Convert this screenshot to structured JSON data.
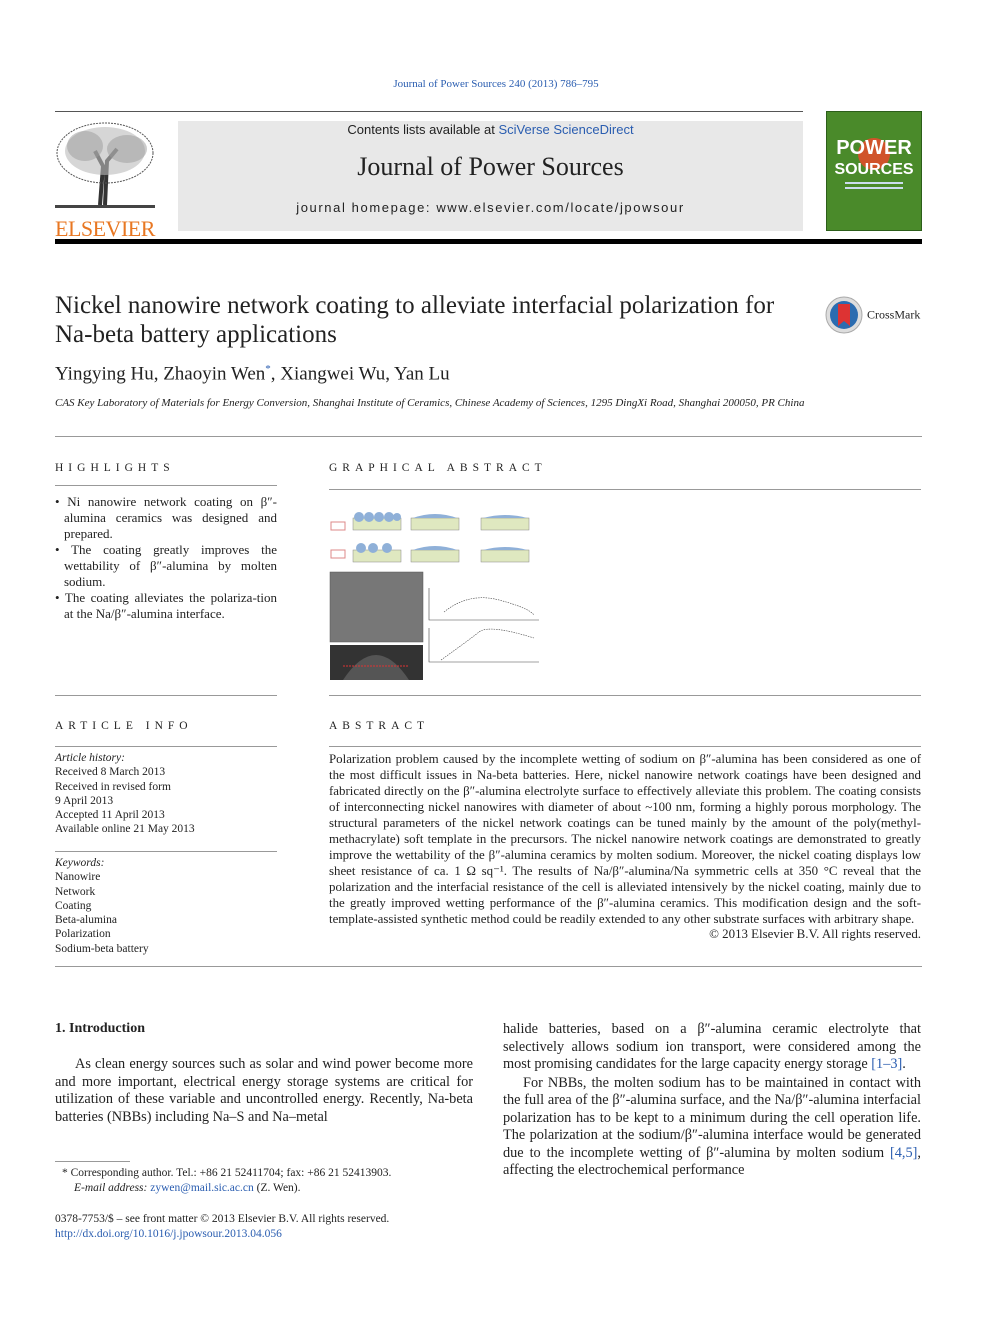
{
  "header": {
    "citation": "Journal of Power Sources 240 (2013) 786–795",
    "contents_prefix": "Contents lists available at ",
    "contents_link": "SciVerse ScienceDirect",
    "journal_title": "Journal of Power Sources",
    "homepage": "journal homepage: www.elsevier.com/locate/jpowsour",
    "publisher_logo": "ELSEVIER",
    "cover_title": "POWER SOURCES",
    "crossmark": "CrossMark"
  },
  "article": {
    "title": "Nickel nanowire network coating to alleviate interfacial polarization for Na-beta battery applications",
    "authors_a": "Yingying Hu, Zhaoyin Wen",
    "author_mark": "*",
    "authors_b": ", Xiangwei Wu, Yan Lu",
    "affiliation": "CAS Key Laboratory of Materials for Energy Conversion, Shanghai Institute of Ceramics, Chinese Academy of Sciences, 1295 DingXi Road, Shanghai 200050, PR China"
  },
  "highlights": {
    "heading": "HIGHLIGHTS",
    "items": [
      "Ni nanowire network coating on β″-alumina ceramics was designed and prepared.",
      "The coating greatly improves the wettability of β″-alumina by molten sodium.",
      "The coating alleviates the polariza-tion at the Na/β″-alumina interface."
    ]
  },
  "graphical_abstract": {
    "heading": "GRAPHICAL ABSTRACT"
  },
  "article_info": {
    "heading": "ARTICLE INFO",
    "history_label": "Article history:",
    "history": [
      "Received 8 March 2013",
      "Received in revised form",
      "9 April 2013",
      "Accepted 11 April 2013",
      "Available online 21 May 2013"
    ],
    "keywords_label": "Keywords:",
    "keywords": [
      "Nanowire",
      "Network",
      "Coating",
      "Beta-alumina",
      "Polarization",
      "Sodium-beta battery"
    ]
  },
  "abstract": {
    "heading": "ABSTRACT",
    "text": "Polarization problem caused by the incomplete wetting of sodium on β″-alumina has been considered as one of the most difficult issues in Na-beta batteries. Here, nickel nanowire network coatings have been designed and fabricated directly on the β″-alumina electrolyte surface to effectively alleviate this problem. The coating consists of interconnecting nickel nanowires with diameter of about ~100 nm, forming a highly porous morphology. The structural parameters of the nickel network coatings can be tuned mainly by the amount of the poly(methyl-methacrylate) soft template in the precursors. The nickel nanowire network coatings are demonstrated to greatly improve the wettability of the β″-alumina ceramics by molten sodium. Moreover, the nickel coating displays low sheet resistance of ca. 1 Ω sq⁻¹. The results of Na/β″-alumina/Na symmetric cells at 350 °C reveal that the polarization and the interfacial resistance of the cell is alleviated intensively by the nickel coating, mainly due to the greatly improved wetting performance of the β″-alumina ceramics. This modification design and the soft-template-assisted synthetic method could be readily extended to any other substrate surfaces with arbitrary shape.",
    "copyright": "© 2013 Elsevier B.V. All rights reserved."
  },
  "intro": {
    "heading": "1.  Introduction",
    "p1": "As clean energy sources such as solar and wind power become more and more important, electrical energy storage systems are critical for utilization of these variable and uncontrolled energy. Recently, Na-beta batteries (NBBs) including Na–S and Na–metal",
    "p2a": "halide batteries, based on a β″-alumina ceramic electrolyte that selectively allows sodium ion transport, were considered among the most promising candidates for the large capacity energy storage ",
    "ref1": "[1–3]",
    "p2b": ".",
    "p3a": "For NBBs, the molten sodium has to be maintained in contact with the full area of the β″-alumina surface, and the Na/β″-alumina interfacial polarization has to be kept to a minimum during the cell operation life. The polarization at the sodium/β″-alumina interface would be generated due to the incomplete wetting of β″-alumina by molten sodium ",
    "ref2": "[4,5]",
    "p3b": ", affecting the electrochemical performance"
  },
  "footnote": {
    "corr": "* Corresponding author. Tel.: +86 21 52411704; fax: +86 21 52413903.",
    "email_label": "E-mail address: ",
    "email": "zywen@mail.sic.ac.cn",
    "email_suffix": " (Z. Wen).",
    "issn": "0378-7753/$ – see front matter © 2013 Elsevier B.V. All rights reserved.",
    "doi": "http://dx.doi.org/10.1016/j.jpowsour.2013.04.056"
  }
}
